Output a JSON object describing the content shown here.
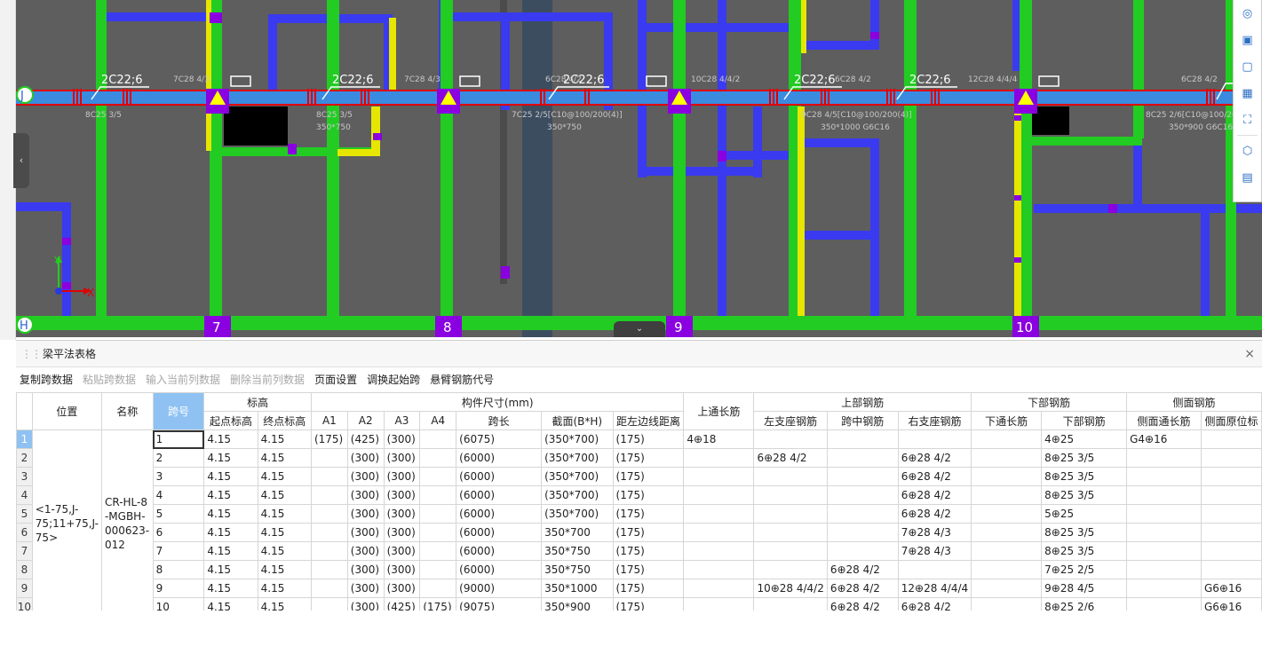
{
  "cad": {
    "axis_labels_top": [
      "7",
      "8",
      "9",
      "10"
    ],
    "row_axis_j": "J",
    "row_axis_h": "H",
    "coord_y": "Y",
    "coord_x": "X",
    "beam_labels": {
      "l1": "2C22;6",
      "l2": "2C22;6",
      "l3": "2C22;6",
      "l4": "2C22;6",
      "l5": "2C22;6",
      "t1": "7C28 4/3",
      "t2": "7C28 4/3",
      "t3": "6C28 4/2",
      "t4": "10C28 4/4/2",
      "t5": "6C28 4/2",
      "t6": "12C28 4/4/4",
      "t7": "6C28 4/2",
      "b1": "8C25 3/5",
      "b2": "8C25 3/5",
      "b2s": "350*750",
      "b3": "7C25 2/5[C10@100/200(4)]",
      "b3s": "350*750",
      "b4": "9C28 4/5[C10@100/200(4)]",
      "b4s": "350*1000 G6C16",
      "b5": "8C25 2/6[C10@100/200(4)]",
      "b5s": "350*900 G6C16"
    }
  },
  "panel": {
    "title": "梁平法表格",
    "toolbar": [
      {
        "label": "复制跨数据",
        "enabled": true
      },
      {
        "label": "粘贴跨数据",
        "enabled": false
      },
      {
        "label": "输入当前列数据",
        "enabled": false
      },
      {
        "label": "删除当前列数据",
        "enabled": false
      },
      {
        "label": "页面设置",
        "enabled": true
      },
      {
        "label": "调换起始跨",
        "enabled": true
      },
      {
        "label": "悬臂钢筋代号",
        "enabled": true
      }
    ]
  },
  "table": {
    "headers": {
      "position": "位置",
      "name": "名称",
      "span_no": "跨号",
      "elevation": "标高",
      "start_elev": "起点标高",
      "end_elev": "终点标高",
      "member_size": "构件尺寸(mm)",
      "a1": "A1",
      "a2": "A2",
      "a3": "A3",
      "a4": "A4",
      "span_len": "跨长",
      "section": "截面(B*H)",
      "edge_dist": "距左边线距离",
      "top_through": "上通长筋",
      "top_rebar": "上部钢筋",
      "left_support": "左支座钢筋",
      "mid_span": "跨中钢筋",
      "right_support": "右支座钢筋",
      "bottom_rebar_group": "下部钢筋",
      "bottom_through": "下通长筋",
      "bottom_rebar": "下部钢筋",
      "side_rebar": "侧面钢筋",
      "side_through": "侧面通长筋",
      "side_orig": "侧面原位标"
    },
    "position": "<1-75,J-75;11+75,J-75>",
    "name": "CR-HL-8-MGBH-000623-012",
    "rows": [
      {
        "n": "1",
        "span": "1",
        "se": "4.15",
        "ee": "4.15",
        "a1": "(175)",
        "a2": "(425)",
        "a3": "(300)",
        "a4": "",
        "len": "(6075)",
        "sec": "(350*700)",
        "edge": "(175)",
        "top": "4⊕18",
        "ls": "",
        "mid": "",
        "rs": "",
        "bt": "",
        "bot": "4⊕25",
        "st": "G4⊕16",
        "so": ""
      },
      {
        "n": "2",
        "span": "2",
        "se": "4.15",
        "ee": "4.15",
        "a1": "",
        "a2": "(300)",
        "a3": "(300)",
        "a4": "",
        "len": "(6000)",
        "sec": "(350*700)",
        "edge": "(175)",
        "top": "",
        "ls": "6⊕28 4/2",
        "mid": "",
        "rs": "6⊕28 4/2",
        "bt": "",
        "bot": "8⊕25 3/5",
        "st": "",
        "so": ""
      },
      {
        "n": "3",
        "span": "3",
        "se": "4.15",
        "ee": "4.15",
        "a1": "",
        "a2": "(300)",
        "a3": "(300)",
        "a4": "",
        "len": "(6000)",
        "sec": "(350*700)",
        "edge": "(175)",
        "top": "",
        "ls": "",
        "mid": "",
        "rs": "6⊕28 4/2",
        "bt": "",
        "bot": "8⊕25 3/5",
        "st": "",
        "so": ""
      },
      {
        "n": "4",
        "span": "4",
        "se": "4.15",
        "ee": "4.15",
        "a1": "",
        "a2": "(300)",
        "a3": "(300)",
        "a4": "",
        "len": "(6000)",
        "sec": "(350*700)",
        "edge": "(175)",
        "top": "",
        "ls": "",
        "mid": "",
        "rs": "6⊕28 4/2",
        "bt": "",
        "bot": "8⊕25 3/5",
        "st": "",
        "so": ""
      },
      {
        "n": "5",
        "span": "5",
        "se": "4.15",
        "ee": "4.15",
        "a1": "",
        "a2": "(300)",
        "a3": "(300)",
        "a4": "",
        "len": "(6000)",
        "sec": "(350*700)",
        "edge": "(175)",
        "top": "",
        "ls": "",
        "mid": "",
        "rs": "6⊕28 4/2",
        "bt": "",
        "bot": "5⊕25",
        "st": "",
        "so": ""
      },
      {
        "n": "6",
        "span": "6",
        "se": "4.15",
        "ee": "4.15",
        "a1": "",
        "a2": "(300)",
        "a3": "(300)",
        "a4": "",
        "len": "(6000)",
        "sec": "350*700",
        "edge": "(175)",
        "top": "",
        "ls": "",
        "mid": "",
        "rs": "7⊕28 4/3",
        "bt": "",
        "bot": "8⊕25 3/5",
        "st": "",
        "so": ""
      },
      {
        "n": "7",
        "span": "7",
        "se": "4.15",
        "ee": "4.15",
        "a1": "",
        "a2": "(300)",
        "a3": "(300)",
        "a4": "",
        "len": "(6000)",
        "sec": "350*750",
        "edge": "(175)",
        "top": "",
        "ls": "",
        "mid": "",
        "rs": "7⊕28 4/3",
        "bt": "",
        "bot": "8⊕25 3/5",
        "st": "",
        "so": ""
      },
      {
        "n": "8",
        "span": "8",
        "se": "4.15",
        "ee": "4.15",
        "a1": "",
        "a2": "(300)",
        "a3": "(300)",
        "a4": "",
        "len": "(6000)",
        "sec": "350*750",
        "edge": "(175)",
        "top": "",
        "ls": "",
        "mid": "6⊕28 4/2",
        "rs": "",
        "bt": "",
        "bot": "7⊕25 2/5",
        "st": "",
        "so": ""
      },
      {
        "n": "9",
        "span": "9",
        "se": "4.15",
        "ee": "4.15",
        "a1": "",
        "a2": "(300)",
        "a3": "(300)",
        "a4": "",
        "len": "(9000)",
        "sec": "350*1000",
        "edge": "(175)",
        "top": "",
        "ls": "10⊕28 4/4/2",
        "mid": "6⊕28 4/2",
        "rs": "12⊕28 4/4/4",
        "bt": "",
        "bot": "9⊕28 4/5",
        "st": "",
        "so": "G6⊕16"
      },
      {
        "n": "10",
        "span": "10",
        "se": "4.15",
        "ee": "4.15",
        "a1": "",
        "a2": "(300)",
        "a3": "(425)",
        "a4": "(175)",
        "len": "(9075)",
        "sec": "350*900",
        "edge": "(175)",
        "top": "",
        "ls": "",
        "mid": "6⊕28 4/2",
        "rs": "6⊕28 4/2",
        "bt": "",
        "bot": "8⊕25 2/6",
        "st": "",
        "so": "G6⊕16"
      }
    ]
  }
}
